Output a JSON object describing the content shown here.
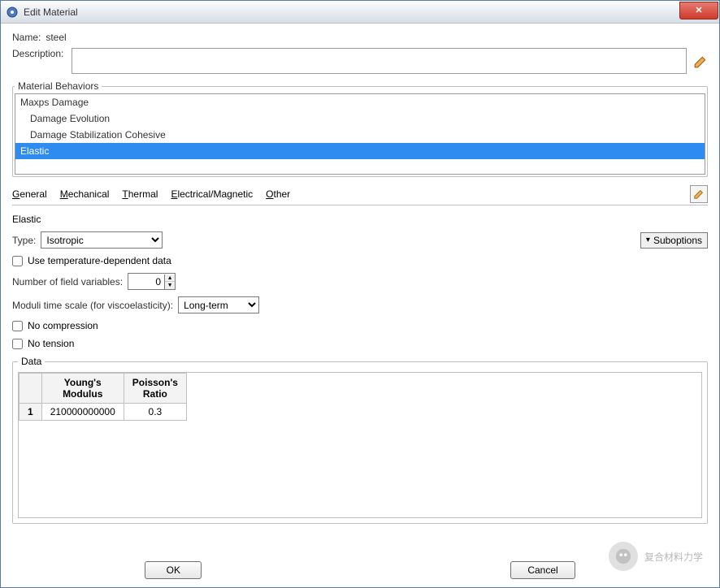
{
  "window": {
    "title": "Edit Material"
  },
  "name": {
    "label": "Name:",
    "value": "steel"
  },
  "description": {
    "label": "Description:",
    "value": ""
  },
  "behaviors": {
    "legend": "Material Behaviors",
    "items": [
      {
        "label": "Maxps Damage",
        "child": false,
        "selected": false
      },
      {
        "label": "Damage Evolution",
        "child": true,
        "selected": false
      },
      {
        "label": "Damage Stabilization Cohesive",
        "child": true,
        "selected": false
      },
      {
        "label": "Elastic",
        "child": false,
        "selected": true
      }
    ]
  },
  "menus": {
    "items": [
      {
        "key": "G",
        "rest": "eneral"
      },
      {
        "key": "M",
        "rest": "echanical"
      },
      {
        "key": "T",
        "rest": "hermal"
      },
      {
        "key": "E",
        "rest": "lectrical/Magnetic"
      },
      {
        "key": "O",
        "rest": "ther"
      }
    ]
  },
  "elastic": {
    "title": "Elastic",
    "type_label": "Type:",
    "type_value": "Isotropic",
    "suboptions_label": "Suboptions",
    "temp_dep_label": "Use temperature-dependent data",
    "temp_dep_checked": false,
    "field_vars_label": "Number of field variables:",
    "field_vars_value": "0",
    "moduli_label": "Moduli time scale (for viscoelasticity):",
    "moduli_value": "Long-term",
    "no_compression_label": "No compression",
    "no_compression_checked": false,
    "no_tension_label": "No tension",
    "no_tension_checked": false
  },
  "data": {
    "legend": "Data",
    "headers": [
      "Young's\nModulus",
      "Poisson's\nRatio"
    ],
    "rows": [
      {
        "n": "1",
        "youngs": "210000000000",
        "poisson": "0.3"
      }
    ]
  },
  "footer": {
    "ok": "OK",
    "cancel": "Cancel"
  },
  "watermark": {
    "text": "复合材料力学"
  }
}
